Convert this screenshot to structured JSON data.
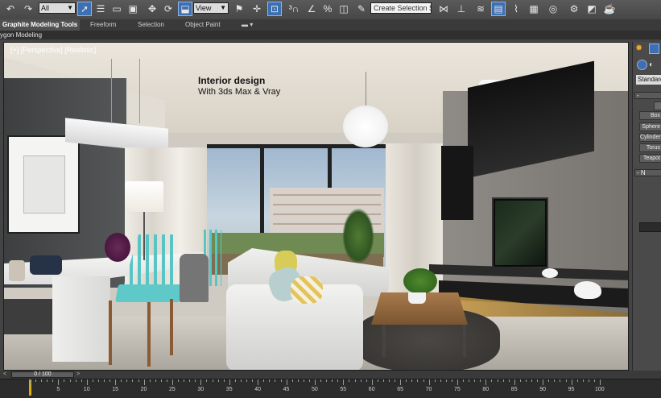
{
  "toolbar": {
    "selection_filter": "All",
    "reference_coord": "View",
    "selection_set_placeholder": "Create Selection Se",
    "icons": [
      "undo-icon",
      "redo-icon",
      "select-icon",
      "select-by-name-icon",
      "region-select-icon",
      "window-crossing-icon",
      "move-icon",
      "rotate-icon",
      "scale-icon",
      "pivot-icon",
      "select-manipulate-icon",
      "keyboard-shortcut-icon",
      "snap-3d-icon",
      "angle-snap-icon",
      "percent-snap-icon",
      "spinner-snap-icon",
      "edit-named-sets-icon",
      "mirror-icon",
      "align-icon",
      "layer-manager-icon",
      "graphite-toggle-icon",
      "curve-editor-icon",
      "schematic-view-icon",
      "material-editor-icon",
      "render-setup-icon",
      "rendered-frame-icon",
      "render-icon"
    ]
  },
  "ribbon": {
    "tabs": [
      "Graphite Modeling Tools",
      "Freeform",
      "Selection",
      "Object Paint"
    ],
    "sub_label": "ygon Modeling"
  },
  "viewport": {
    "label": "[+] [Perspective] [Realistic]",
    "overlay_title": "Interior design",
    "overlay_subtitle": "With 3ds Max & Vray"
  },
  "command_panel": {
    "dropdown": "Standard",
    "object_buttons": [
      "Box",
      "Sphere",
      "Cylinder",
      "Torus",
      "Teapot"
    ],
    "rollout_1": "-",
    "rollout_2": "- N"
  },
  "timeline": {
    "frame_display": "0 / 100",
    "prev_arrow": "<",
    "next_arrow": ">",
    "ruler_labels": [
      "5",
      "10",
      "15",
      "20",
      "25",
      "30",
      "35",
      "40",
      "45",
      "50",
      "55",
      "60",
      "65",
      "70",
      "75",
      "80",
      "85",
      "90",
      "95",
      "100"
    ]
  },
  "colors": {
    "ui_dark": "#444444",
    "active_tool": "#3d6fb3",
    "key_marker": "#e0b000"
  }
}
